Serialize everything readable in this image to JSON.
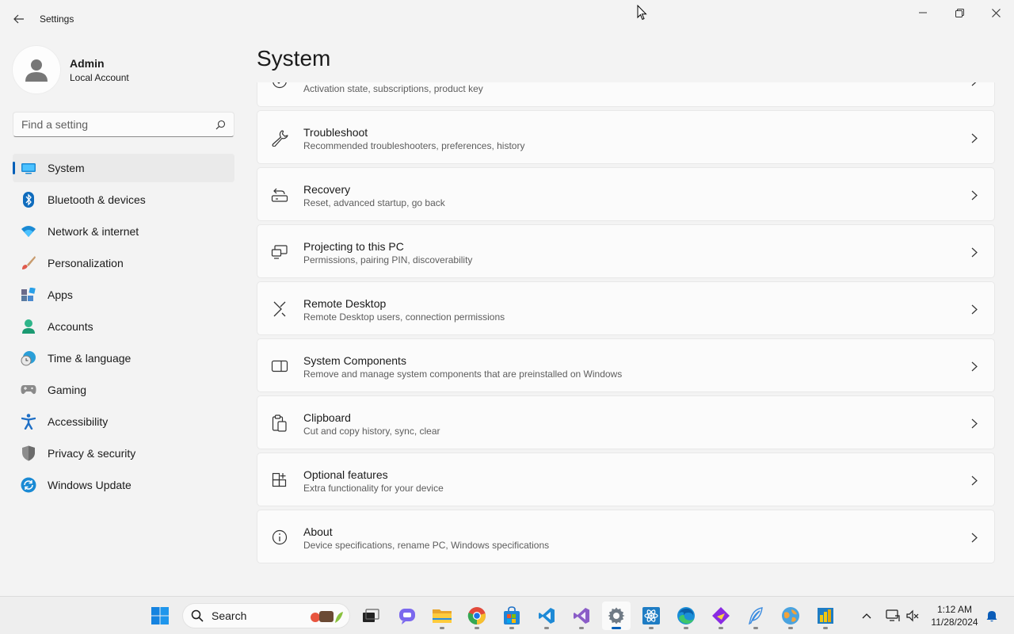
{
  "window": {
    "title": "Settings"
  },
  "profile": {
    "name": "Admin",
    "account_type": "Local Account"
  },
  "search": {
    "placeholder": "Find a setting"
  },
  "nav": {
    "items": [
      {
        "label": "System",
        "icon": "system-icon",
        "active": true
      },
      {
        "label": "Bluetooth & devices",
        "icon": "bluetooth-icon"
      },
      {
        "label": "Network & internet",
        "icon": "wifi-icon"
      },
      {
        "label": "Personalization",
        "icon": "brush-icon"
      },
      {
        "label": "Apps",
        "icon": "apps-icon"
      },
      {
        "label": "Accounts",
        "icon": "accounts-icon"
      },
      {
        "label": "Time & language",
        "icon": "clock-globe-icon"
      },
      {
        "label": "Gaming",
        "icon": "gamepad-icon"
      },
      {
        "label": "Accessibility",
        "icon": "accessibility-icon"
      },
      {
        "label": "Privacy & security",
        "icon": "shield-icon"
      },
      {
        "label": "Windows Update",
        "icon": "update-icon"
      }
    ]
  },
  "main": {
    "title": "System",
    "items": [
      {
        "title": "",
        "subtitle": "Activation state, subscriptions, product key",
        "icon": "activation-icon"
      },
      {
        "title": "Troubleshoot",
        "subtitle": "Recommended troubleshooters, preferences, history",
        "icon": "wrench-icon"
      },
      {
        "title": "Recovery",
        "subtitle": "Reset, advanced startup, go back",
        "icon": "recovery-icon"
      },
      {
        "title": "Projecting to this PC",
        "subtitle": "Permissions, pairing PIN, discoverability",
        "icon": "projecting-icon"
      },
      {
        "title": "Remote Desktop",
        "subtitle": "Remote Desktop users, connection permissions",
        "icon": "remote-desktop-icon"
      },
      {
        "title": "System Components",
        "subtitle": "Remove and manage system components that are preinstalled on Windows",
        "icon": "components-icon"
      },
      {
        "title": "Clipboard",
        "subtitle": "Cut and copy history, sync, clear",
        "icon": "clipboard-icon"
      },
      {
        "title": "Optional features",
        "subtitle": "Extra functionality for your device",
        "icon": "optional-features-icon"
      },
      {
        "title": "About",
        "subtitle": "Device specifications, rename PC, Windows specifications",
        "icon": "info-icon"
      }
    ]
  },
  "taskbar": {
    "search_label": "Search",
    "time": "1:12 AM",
    "date": "11/28/2024",
    "accent": "#005fb8"
  }
}
